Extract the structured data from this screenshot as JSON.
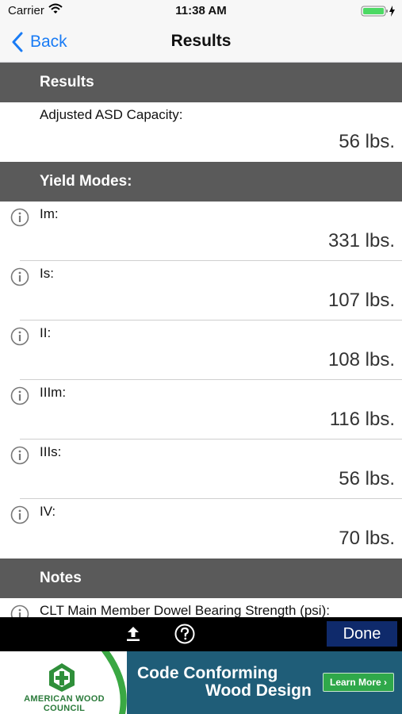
{
  "status_bar": {
    "carrier": "Carrier",
    "time": "11:38 AM"
  },
  "nav": {
    "back_label": "Back",
    "title": "Results"
  },
  "sections": {
    "results": {
      "header": "Results",
      "capacity_label": "Adjusted ASD Capacity:",
      "capacity_value": "56 lbs."
    },
    "yield_modes": {
      "header": "Yield Modes:",
      "rows": [
        {
          "label": "Im:",
          "value": "331 lbs."
        },
        {
          "label": "Is:",
          "value": "107 lbs."
        },
        {
          "label": "II:",
          "value": "108 lbs."
        },
        {
          "label": "IIIm:",
          "value": "116 lbs."
        },
        {
          "label": "IIIs:",
          "value": "56 lbs."
        },
        {
          "label": "IV:",
          "value": "70 lbs."
        }
      ]
    },
    "notes": {
      "header": "Notes",
      "first_note": "CLT Main Member Dowel Bearing Strength (psi):"
    }
  },
  "toolbar": {
    "done_label": "Done"
  },
  "ad": {
    "org_name": "AMERICAN WOOD COUNCIL",
    "line1": "Code Conforming",
    "line2": "Wood Design",
    "cta": "Learn More ›"
  },
  "colors": {
    "section_header_bg": "#5a5a5a",
    "accent_blue": "#1a7cf5",
    "done_bg": "#0f2a6b",
    "ad_teal": "#1f5d78",
    "ad_green": "#2fa84a",
    "battery_green": "#4cd964"
  }
}
